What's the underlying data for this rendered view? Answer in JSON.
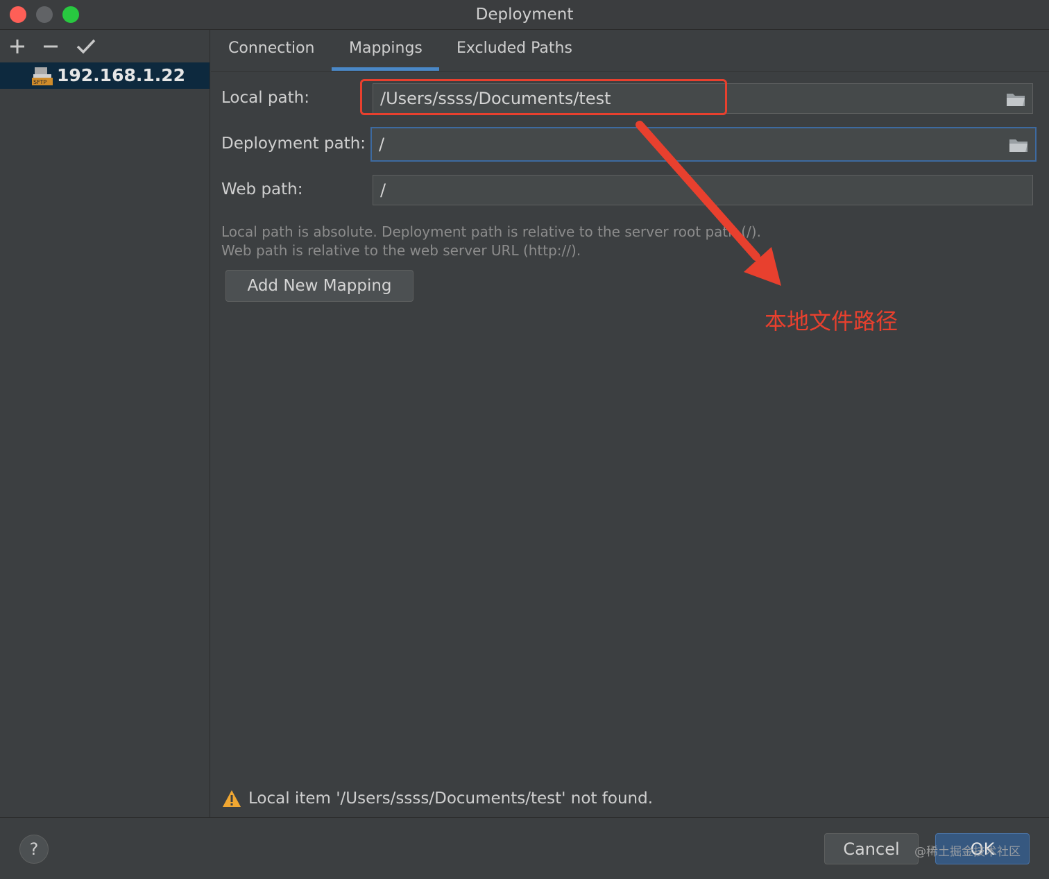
{
  "window": {
    "title": "Deployment"
  },
  "sidebar": {
    "toolbar": {
      "add": "+",
      "remove": "−",
      "apply": "✓"
    },
    "servers": [
      {
        "label": "192.168.1.22",
        "icon": "sftp-server-icon"
      }
    ]
  },
  "tabs": [
    {
      "label": "Connection"
    },
    {
      "label": "Mappings",
      "active": true
    },
    {
      "label": "Excluded Paths"
    }
  ],
  "mapping": {
    "local_path_label": "Local path:",
    "local_path_value": "/Users/ssss/Documents/test",
    "deployment_path_label": "Deployment path:",
    "deployment_path_value": "/",
    "web_path_label": "Web path:",
    "web_path_value": "/",
    "hint_line1": "Local path is absolute. Deployment path is relative to the server root path (/).",
    "hint_line2": "Web path is relative to the web server URL (http://).",
    "add_button": "Add New Mapping"
  },
  "annotation": {
    "text": "本地文件路径",
    "color": "#e8402e"
  },
  "warning": {
    "text": "Local item '/Users/ssss/Documents/test' not found."
  },
  "footer": {
    "help": "?",
    "cancel": "Cancel",
    "ok": "OK",
    "watermark": "@稀土掘金技术社区"
  },
  "colors": {
    "accent": "#4a88c7",
    "selection": "#0d293e",
    "annotation": "#e8402e",
    "ok_button": "#365880"
  }
}
